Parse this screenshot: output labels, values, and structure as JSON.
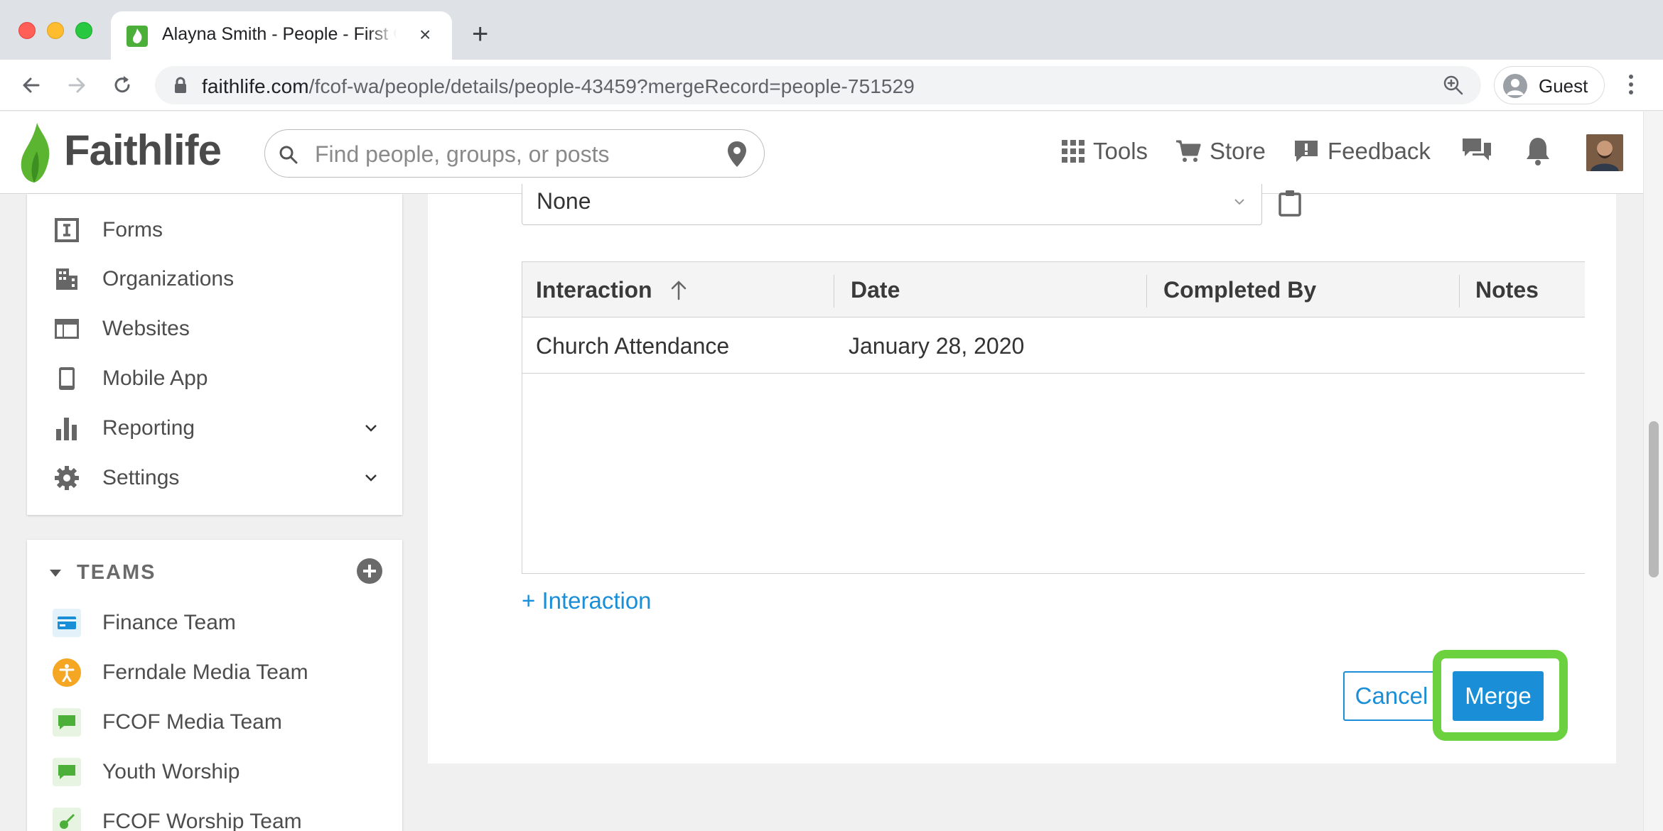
{
  "browser": {
    "tab_title": "Alayna Smith - People - First Church of Faithlife",
    "tab_close": "×",
    "new_tab": "+",
    "url_host": "faithlife.com",
    "url_path": "/fcof-wa/people/details/people-43459?mergeRecord=people-751529",
    "profile_label": "Guest"
  },
  "header": {
    "logo_text": "Faithlife",
    "search_placeholder": "Find people, groups, or posts",
    "tools_label": "Tools",
    "store_label": "Store",
    "feedback_label": "Feedback"
  },
  "sidebar": {
    "items": [
      {
        "label": "Forms",
        "icon": "forms-icon"
      },
      {
        "label": "Organizations",
        "icon": "organizations-icon"
      },
      {
        "label": "Websites",
        "icon": "websites-icon"
      },
      {
        "label": "Mobile App",
        "icon": "mobile-app-icon"
      },
      {
        "label": "Reporting",
        "icon": "reporting-icon"
      },
      {
        "label": "Settings",
        "icon": "settings-icon"
      }
    ]
  },
  "teams": {
    "title": "TEAMS",
    "items": [
      {
        "label": "Finance Team",
        "color": "#1a8fd8"
      },
      {
        "label": "Ferndale Media Team",
        "color": "#f5a623"
      },
      {
        "label": "FCOF Media Team",
        "color": "#4caf3a"
      },
      {
        "label": "Youth Worship",
        "color": "#4caf3a"
      },
      {
        "label": "FCOF Worship Team",
        "color": "#4caf3a"
      }
    ]
  },
  "main": {
    "select_value": "None",
    "table": {
      "columns": [
        "Interaction",
        "Date",
        "Completed By",
        "Notes"
      ],
      "rows": [
        [
          "Church Attendance",
          "January 28, 2020",
          "",
          ""
        ]
      ]
    },
    "add_interaction_label": "+ Interaction",
    "cancel_label": "Cancel",
    "merge_label": "Merge"
  },
  "colors": {
    "accent": "#1a8fd8",
    "highlight": "#6bd13f",
    "brand_green": "#4caf3a"
  }
}
